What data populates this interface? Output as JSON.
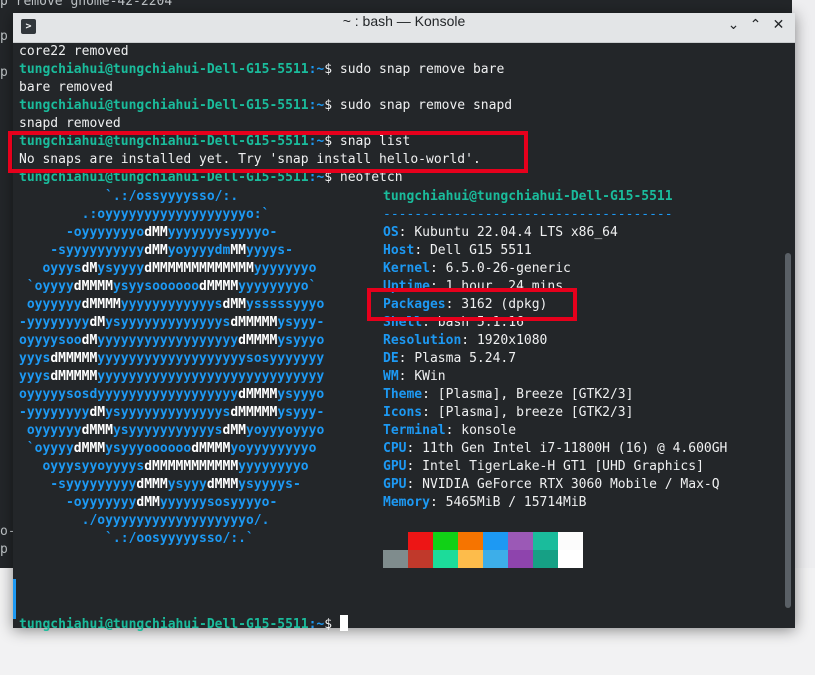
{
  "background": {
    "lines": [
      "p remove gnome-42-2204",
      "p",
      "p",
      "o-",
      "p"
    ]
  },
  "window": {
    "title": "~ : bash — Konsole",
    "icon": "terminal-icon",
    "controls": [
      "chevron-down-icon",
      "chevron-up-icon",
      "close-icon"
    ]
  },
  "terminal": {
    "prompt_user": "tungchiahui@tungchiahui-Dell-G15-5511",
    "prompt_path": ":~",
    "prompt_sym": "$",
    "lines": [
      {
        "text": "core22 removed"
      },
      {
        "cmd": "sudo snap remove bare"
      },
      {
        "text": "bare removed"
      },
      {
        "cmd": "sudo snap remove snapd"
      },
      {
        "text": "snapd removed"
      },
      {
        "cmd": "snap list"
      },
      {
        "text": "No snaps are installed yet. Try 'snap install hello-world'."
      },
      {
        "cmd": "neofetch"
      }
    ],
    "final_prompt": "tungchiahui@tungchiahui-Dell-G15-5511:~$"
  },
  "neofetch": {
    "logo": [
      "           `.:/ossyyyysso/:.",
      "        .:oyyyyyyyyyyyyyyyyyyo:`",
      "      -oyyyyyyyodMMyyyyyyysyyyyo-",
      "    -syyyyyyyyyydMMyoyyyydmMMyyyys-",
      "   oyyysdMysyyyydMMMMMMMMMMMMMyyyyyyyo",
      " `oyyyydMMMMysyysoooooodMMMMyyyyyyyyo`",
      " oyyyyyydMMMMyyyyyyyyyyyysdMMysssssyyyo",
      "-yyyyyyyydMysyyyyyyyyyyyyysdMMMMMysyyy-",
      "oyyyysoodMyyyyyyyyyyyyyyyyyydMMMMysyyyo",
      "yyysdMMMMMyyyyyyyyyyyyyyyyyyysosyyyyyyy",
      "yyysdMMMMMyyyyyyyyyyyyyyyyyyyyyyyyyyyyy",
      "oyyyyysosdyyyyyyyyyyyyyyyyyydMMMMysyyyo",
      "-yyyyyyyydMysyyyyyyyyyyyyysdMMMMMysyyy-",
      " oyyyyyydMMMysyyyyyyyyyyysdMMyoyyyoyyyo",
      " `oyyyydMMMysyyyoooooodMMMMyoyyyyyyyyo",
      "   oyyysyyoyyyysdMMMMMMMMMMMyyyyyyyyo",
      "    -syyyyyyyyydMMMysyyydMMMysyyyys-",
      "      -oyyyyyyydMMyyyyyysosyyyyo-",
      "        ./oyyyyyyyyyyyyyyyyyyo/.",
      "           `.:/oosyyyyysso/:.`"
    ],
    "header": "tungchiahui@tungchiahui-Dell-G15-5511",
    "separator": "-------------------------------------",
    "info": [
      {
        "key": "OS",
        "value": "Kubuntu 22.04.4 LTS x86_64"
      },
      {
        "key": "Host",
        "value": "Dell G15 5511"
      },
      {
        "key": "Kernel",
        "value": "6.5.0-26-generic"
      },
      {
        "key": "Uptime",
        "value": "1 hour, 24 mins"
      },
      {
        "key": "Packages",
        "value": "3162 (dpkg)"
      },
      {
        "key": "Shell",
        "value": "bash 5.1.16"
      },
      {
        "key": "Resolution",
        "value": "1920x1080"
      },
      {
        "key": "DE",
        "value": "Plasma 5.24.7"
      },
      {
        "key": "WM",
        "value": "KWin"
      },
      {
        "key": "Theme",
        "value": "[Plasma], Breeze [GTK2/3]"
      },
      {
        "key": "Icons",
        "value": "[Plasma], breeze [GTK2/3]"
      },
      {
        "key": "Terminal",
        "value": "konsole"
      },
      {
        "key": "CPU",
        "value": "11th Gen Intel i7-11800H (16) @ 4.600GH"
      },
      {
        "key": "GPU",
        "value": "Intel TigerLake-H GT1 [UHD Graphics]"
      },
      {
        "key": "GPU",
        "value": "NVIDIA GeForce RTX 3060 Mobile / Max-Q"
      },
      {
        "key": "Memory",
        "value": "5465MiB / 15714MiB"
      }
    ],
    "palette_top": [
      "#232629",
      "#ed1515",
      "#11d116",
      "#f67400",
      "#1d99f3",
      "#9b59b6",
      "#1abc9c",
      "#fcfcfc"
    ],
    "palette_bottom": [
      "#7f8c8d",
      "#c0392b",
      "#1cdc9a",
      "#fdbc4b",
      "#3daee9",
      "#8e44ad",
      "#16a085",
      "#ffffff"
    ]
  },
  "highlight_color": "#e6001c"
}
